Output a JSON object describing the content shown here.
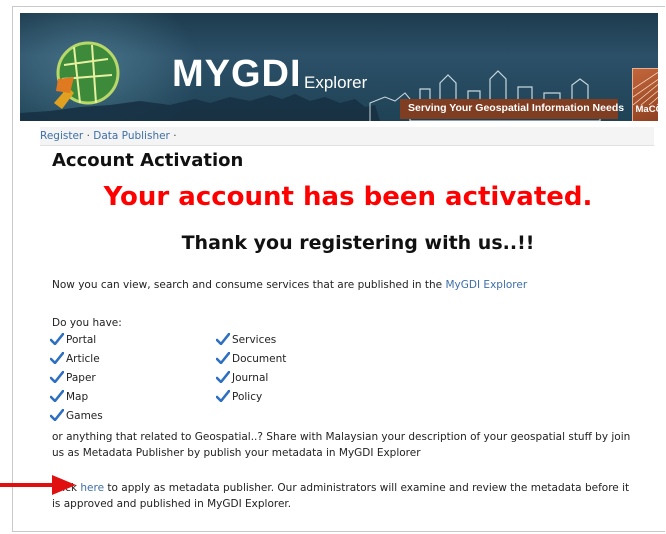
{
  "header": {
    "brand_main": "MYGDI",
    "brand_sub": "Explorer",
    "tagline": "Serving Your Geospatial Information Needs",
    "org_logo_text": "MaCGDI"
  },
  "nav": {
    "register": "Register",
    "separator": "·",
    "data_publisher": "Data Publisher",
    "trailing_separator": "·"
  },
  "page": {
    "title": "Account Activation",
    "activated_message": "Your account has been activated.",
    "thank_you": "Thank you registering with us..!!",
    "intro_text": "Now you can view, search and consume services that are published in the",
    "intro_link": "MyGDI Explorer",
    "do_you_have": "Do you have:",
    "items_left": [
      "Portal",
      "Article",
      "Paper",
      "Map",
      "Games"
    ],
    "items_right": [
      "Services",
      "Document",
      "Journal",
      "Policy"
    ],
    "share_line1": "or anything that related to Geospatial..? Share with Malaysian your description of your geospatial stuff by join",
    "share_line2": "us as Metadata Publisher by publish your metadata in MyGDI Explorer",
    "click_prefix": "Click",
    "click_link": "here",
    "click_line1_rest": "to apply as metadata publisher. Our administrators will examine and review the metadata before it",
    "click_line2": "is approved and published in MyGDI Explorer."
  },
  "colors": {
    "accent_red": "#ff0000",
    "link_blue": "#3d6fa8",
    "check_blue": "#2e6fc2",
    "banner_dark": "#1f4255"
  }
}
